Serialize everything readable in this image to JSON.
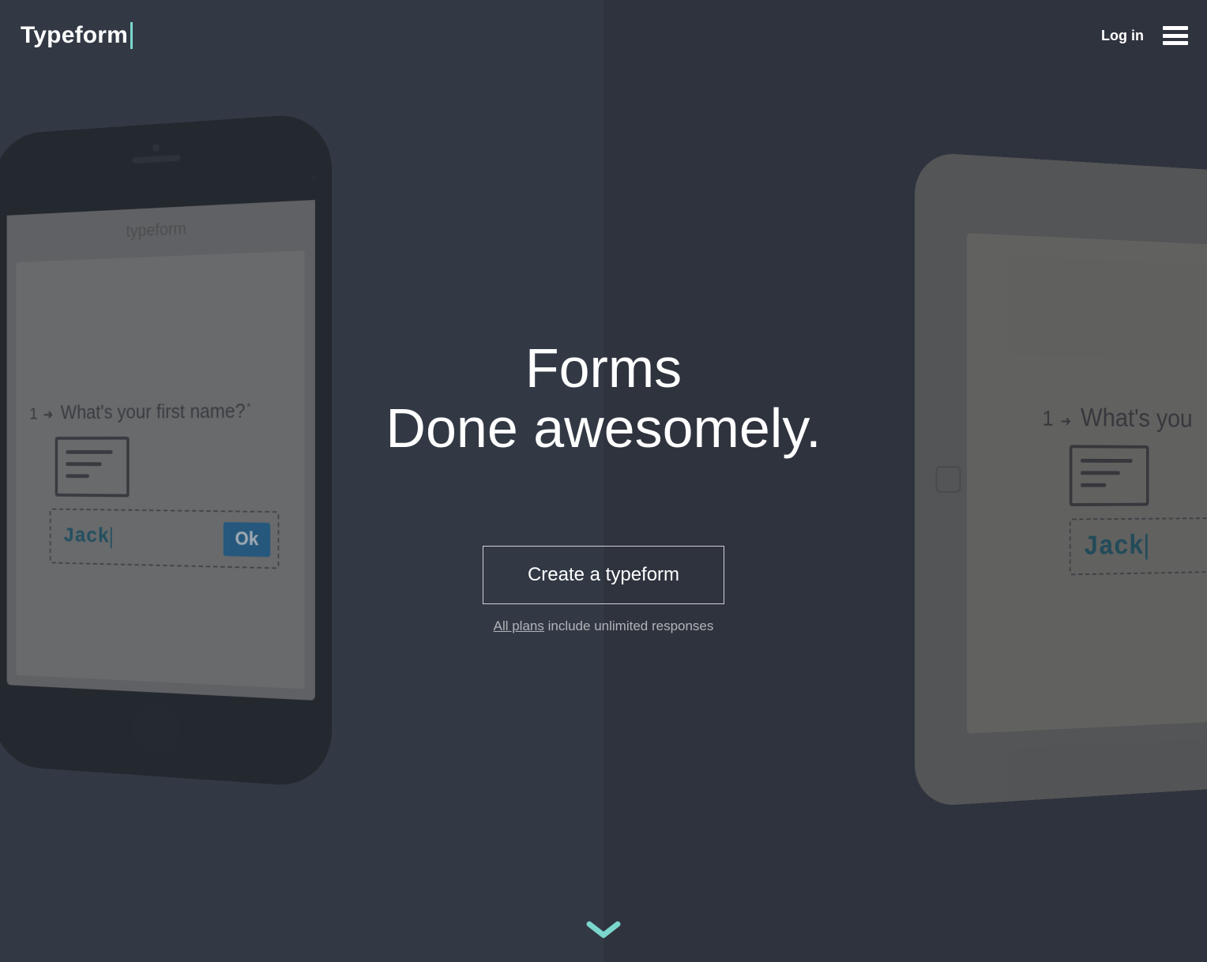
{
  "logo": {
    "text": "Typeform"
  },
  "nav": {
    "login": "Log in"
  },
  "hero": {
    "title": "Forms",
    "subtitle": "Done awesomely.",
    "cta": "Create a typeform",
    "plans_link": "All plans",
    "plans_rest": " include unlimited responses"
  },
  "phone": {
    "url": "typeform",
    "question_number": "1",
    "question_text": "What's your first name?",
    "input_value": "Jack",
    "ok_label": "Ok"
  },
  "tablet": {
    "question_number": "1",
    "question_text_partial": "What's you",
    "input_value": "Jack"
  }
}
